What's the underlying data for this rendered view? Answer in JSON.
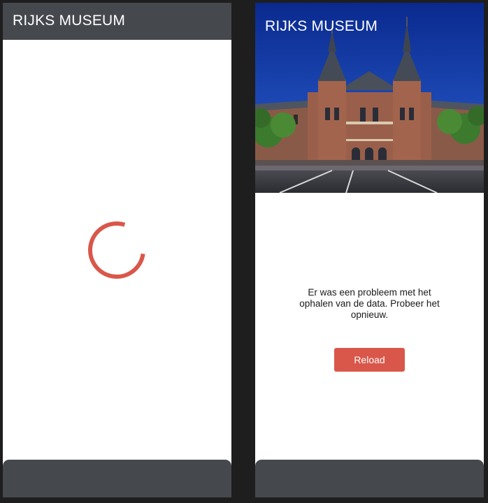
{
  "loading_screen": {
    "app_title": "RIJKS MUSEUM",
    "spinner_color": "#d9574a"
  },
  "error_screen": {
    "app_title": "RIJKS MUSEUM",
    "hero_image": "rijksmuseum-building-photo",
    "error_message": "Er was een probleem met het ophalen van de data. Probeer het opnieuw.",
    "reload_label": "Reload"
  },
  "colors": {
    "header_bg": "#45484d",
    "accent": "#d9574a",
    "outer_bg": "#1e1e1e"
  }
}
